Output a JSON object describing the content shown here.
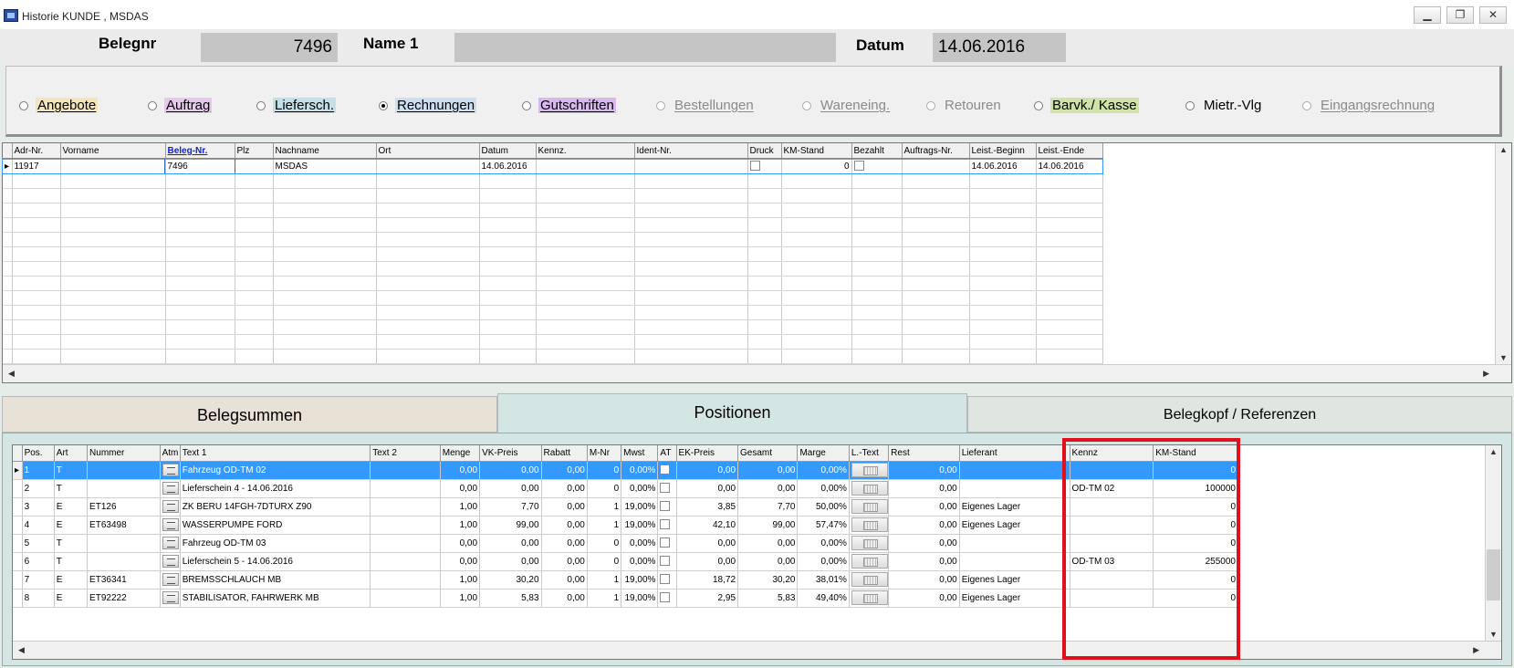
{
  "window": {
    "title": "Historie KUNDE , MSDAS",
    "buttons": [
      "▁",
      "❐",
      "✕"
    ]
  },
  "header": {
    "belegnr_label": "Belegnr",
    "belegnr_value": "7496",
    "name_label": "Name 1",
    "name_value": "",
    "datum_label": "Datum",
    "datum_value": "14.06.2016"
  },
  "doc_types": [
    {
      "label": "Angebote",
      "selected": false,
      "color": "#f3e5b8",
      "enabled": true
    },
    {
      "label": "Auftrag",
      "selected": false,
      "color": "#e6c8ec",
      "enabled": true
    },
    {
      "label": "Liefersch.",
      "selected": false,
      "color": "#c4dfe8",
      "enabled": true
    },
    {
      "label": "Rechnungen",
      "selected": true,
      "color": "#cde0f2",
      "enabled": true
    },
    {
      "label": "Gutschriften",
      "selected": false,
      "color": "#d9b8ee",
      "enabled": true
    },
    {
      "label": "Bestellungen",
      "selected": false,
      "color": "",
      "enabled": false
    },
    {
      "label": "Wareneing.",
      "selected": false,
      "color": "",
      "enabled": false
    },
    {
      "label": "Retouren",
      "selected": false,
      "color": "",
      "enabled": false
    },
    {
      "label": "Barvk./ Kasse",
      "selected": false,
      "color": "#cfe3a8",
      "enabled": true
    },
    {
      "label": "Mietr.-Vlg",
      "selected": false,
      "color": "",
      "enabled": true
    },
    {
      "label": "Eingangsrechnung",
      "selected": false,
      "color": "",
      "enabled": false
    }
  ],
  "doc_grid": {
    "columns": [
      "Adr-Nr.",
      "Vorname",
      "Beleg-Nr.",
      "Plz",
      "Nachname",
      "Ort",
      "Datum",
      "Kennz.",
      "Ident-Nr.",
      "Druck",
      "KM-Stand",
      "Bezahlt",
      "Auftrags-Nr.",
      "Leist.-Beginn",
      "Leist.-Ende"
    ],
    "rows": [
      {
        "adr": "11917",
        "vorname": "",
        "beleg": "7496",
        "plz": "",
        "nachname": "MSDAS",
        "ort": "",
        "datum": "14.06.2016",
        "kennz": "",
        "ident": "",
        "km": "0",
        "auftrag": "",
        "beginn": "14.06.2016",
        "ende": "14.06.2016"
      }
    ]
  },
  "tabs": [
    "Belegsummen",
    "Positionen",
    "Belegkopf / Referenzen"
  ],
  "positions": {
    "columns": [
      "Pos.",
      "Art",
      "Nummer",
      "Atm",
      "Text 1",
      "Text 2",
      "Menge",
      "VK-Preis",
      "Rabatt",
      "M-Nr",
      "Mwst",
      "AT",
      "EK-Preis",
      "Gesamt",
      "Marge",
      "L.-Text",
      "Rest",
      "Lieferant",
      "Kennz",
      "KM-Stand"
    ],
    "rows": [
      {
        "pos": "1",
        "art": "T",
        "nummer": "",
        "text1": "Fahrzeug OD-TM 02",
        "text2": "",
        "menge": "0,00",
        "vk": "0,00",
        "rabatt": "0,00",
        "mnr": "0",
        "mwst": "0,00%",
        "ek": "0,00",
        "gesamt": "0,00",
        "marge": "0,00%",
        "rest": "0,00",
        "lieferant": "",
        "kennz": "",
        "km": "0"
      },
      {
        "pos": "2",
        "art": "T",
        "nummer": "",
        "text1": "Lieferschein 4 - 14.06.2016",
        "text2": "",
        "menge": "0,00",
        "vk": "0,00",
        "rabatt": "0,00",
        "mnr": "0",
        "mwst": "0,00%",
        "ek": "0,00",
        "gesamt": "0,00",
        "marge": "0,00%",
        "rest": "0,00",
        "lieferant": "",
        "kennz": "OD-TM 02",
        "km": "100000"
      },
      {
        "pos": "3",
        "art": "E",
        "nummer": "ET126",
        "text1": "ZK BERU 14FGH-7DTURX Z90",
        "text2": "",
        "menge": "1,00",
        "vk": "7,70",
        "rabatt": "0,00",
        "mnr": "1",
        "mwst": "19,00%",
        "ek": "3,85",
        "gesamt": "7,70",
        "marge": "50,00%",
        "rest": "0,00",
        "lieferant": "Eigenes Lager",
        "kennz": "",
        "km": "0"
      },
      {
        "pos": "4",
        "art": "E",
        "nummer": "ET63498",
        "text1": "WASSERPUMPE FORD",
        "text2": "",
        "menge": "1,00",
        "vk": "99,00",
        "rabatt": "0,00",
        "mnr": "1",
        "mwst": "19,00%",
        "ek": "42,10",
        "gesamt": "99,00",
        "marge": "57,47%",
        "rest": "0,00",
        "lieferant": "Eigenes Lager",
        "kennz": "",
        "km": "0"
      },
      {
        "pos": "5",
        "art": "T",
        "nummer": "",
        "text1": "Fahrzeug OD-TM 03",
        "text2": "",
        "menge": "0,00",
        "vk": "0,00",
        "rabatt": "0,00",
        "mnr": "0",
        "mwst": "0,00%",
        "ek": "0,00",
        "gesamt": "0,00",
        "marge": "0,00%",
        "rest": "0,00",
        "lieferant": "",
        "kennz": "",
        "km": "0"
      },
      {
        "pos": "6",
        "art": "T",
        "nummer": "",
        "text1": "Lieferschein 5 - 14.06.2016",
        "text2": "",
        "menge": "0,00",
        "vk": "0,00",
        "rabatt": "0,00",
        "mnr": "0",
        "mwst": "0,00%",
        "ek": "0,00",
        "gesamt": "0,00",
        "marge": "0,00%",
        "rest": "0,00",
        "lieferant": "",
        "kennz": "OD-TM 03",
        "km": "255000"
      },
      {
        "pos": "7",
        "art": "E",
        "nummer": "ET36341",
        "text1": "BREMSSCHLAUCH MB",
        "text2": "",
        "menge": "1,00",
        "vk": "30,20",
        "rabatt": "0,00",
        "mnr": "1",
        "mwst": "19,00%",
        "ek": "18,72",
        "gesamt": "30,20",
        "marge": "38,01%",
        "rest": "0,00",
        "lieferant": "Eigenes Lager",
        "kennz": "",
        "km": "0"
      },
      {
        "pos": "8",
        "art": "E",
        "nummer": "ET92222",
        "text1": "STABILISATOR, FAHRWERK MB",
        "text2": "",
        "menge": "1,00",
        "vk": "5,83",
        "rabatt": "0,00",
        "mnr": "1",
        "mwst": "19,00%",
        "ek": "2,95",
        "gesamt": "5,83",
        "marge": "49,40%",
        "rest": "0,00",
        "lieferant": "Eigenes Lager",
        "kennz": "",
        "km": "0"
      }
    ]
  },
  "colors": {
    "selection": "#3399ff",
    "highlight_box": "#e0101c",
    "tab_active": "#d4e6e4",
    "tab_left": "#e7e1d6"
  }
}
